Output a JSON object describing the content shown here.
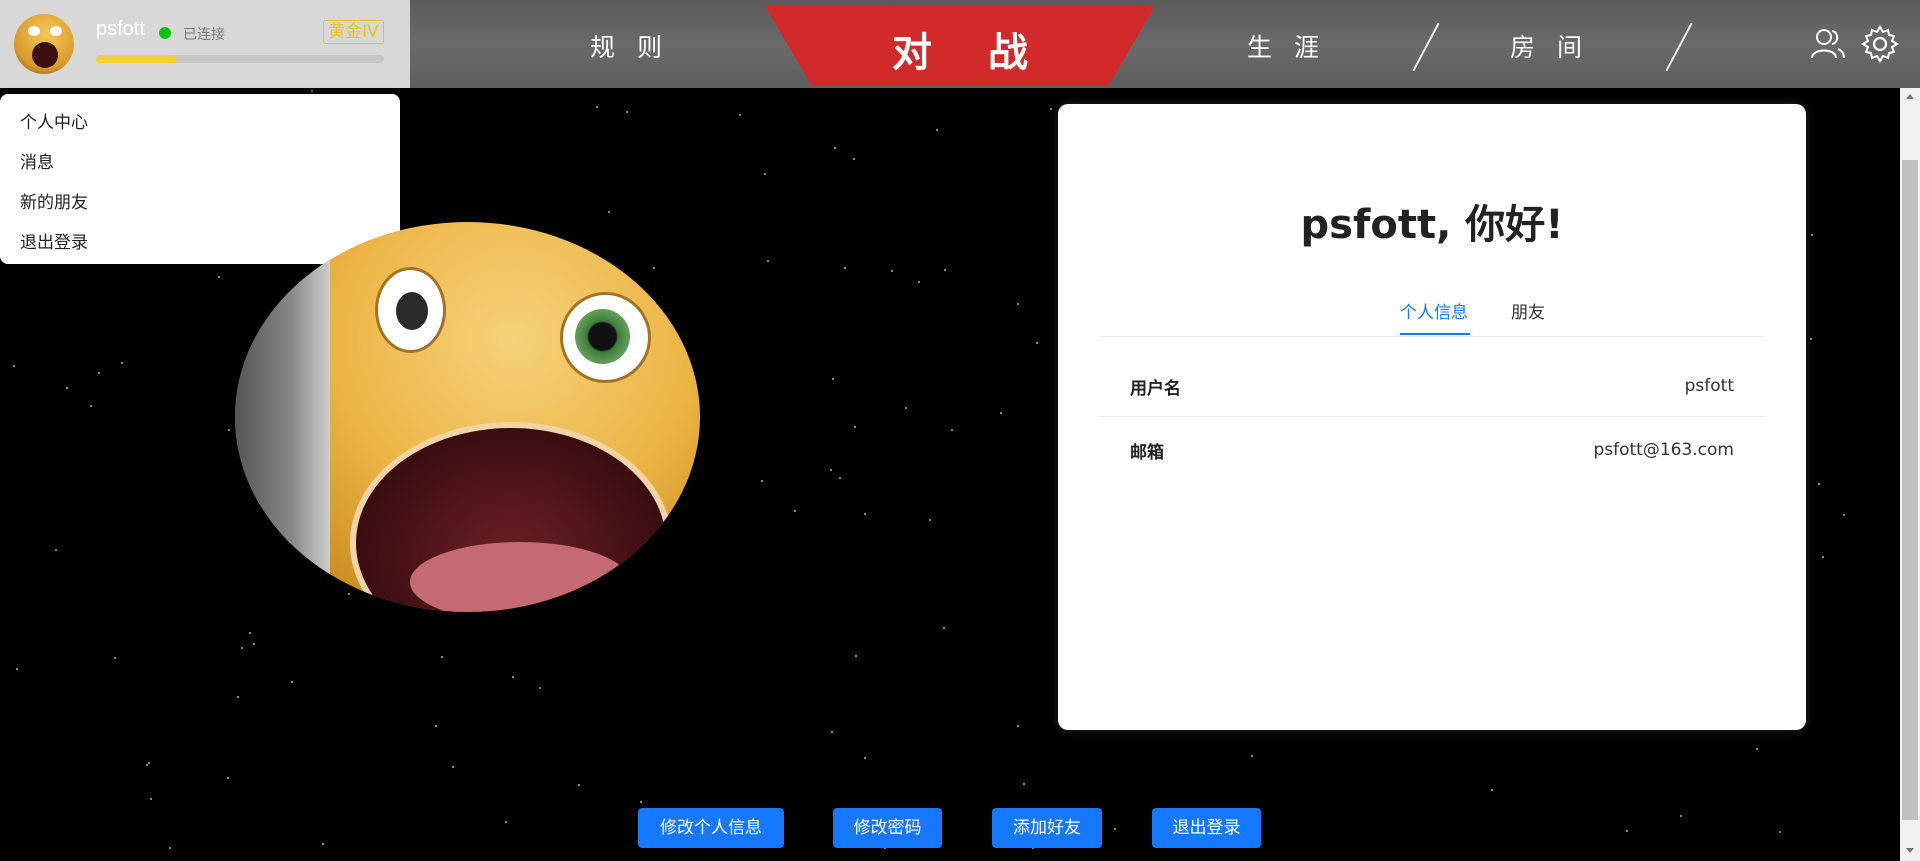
{
  "header": {
    "username": "psfott",
    "connection_status": "已连接",
    "rank": "黄金IV",
    "xp_progress_percent": 28,
    "nav": {
      "rules": "规则",
      "battle": "对战",
      "career": "生涯",
      "room": "房间"
    },
    "icons": [
      "friends-icon",
      "settings-icon"
    ]
  },
  "user_menu": {
    "items": [
      "个人中心",
      "消息",
      "新的朋友",
      "退出登录"
    ]
  },
  "profile": {
    "greeting": "psfott, 你好!",
    "tabs": [
      "个人信息",
      "朋友"
    ],
    "fields": [
      {
        "label": "用户名",
        "value": "psfott"
      },
      {
        "label": "邮箱",
        "value": "psfott@163.com"
      }
    ]
  },
  "actions": {
    "edit_info": "修改个人信息",
    "change_password": "修改密码",
    "add_friend": "添加好友",
    "logout": "退出登录"
  },
  "colors": {
    "accent": "#1677ff",
    "battle_tab": "#d22a2a",
    "online": "#13c113",
    "rank": "#e8c417"
  }
}
